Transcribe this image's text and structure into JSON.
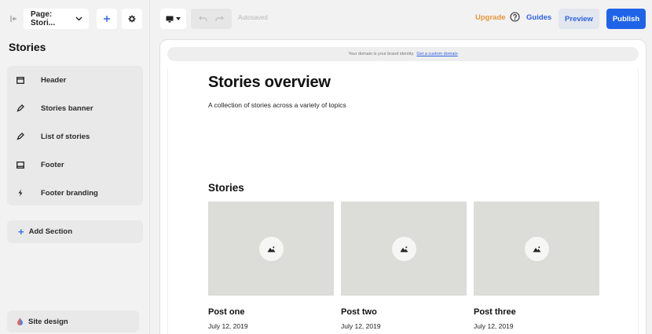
{
  "sidebar": {
    "page_selector": "Page: Stori...",
    "title": "Stories",
    "sections": [
      {
        "label": "Header",
        "icon": "window-icon"
      },
      {
        "label": "Stories banner",
        "icon": "pencil-icon"
      },
      {
        "label": "List of stories",
        "icon": "pencil-icon"
      },
      {
        "label": "Footer",
        "icon": "window-icon"
      },
      {
        "label": "Footer branding",
        "icon": "lightning-icon"
      }
    ],
    "add_section": "Add Section",
    "site_design": "Site design"
  },
  "toolbar": {
    "autosaved": "Autosaved",
    "upgrade": "Upgrade",
    "guides": "Guides",
    "preview": "Preview",
    "publish": "Publish"
  },
  "canvas": {
    "domain_notice": "Your domain is your brand identity.",
    "domain_link": "Get a custom domain",
    "hero_title": "Stories overview",
    "hero_subtitle": "A collection of stories across a variety of topics",
    "stories_heading": "Stories",
    "posts": [
      {
        "title": "Post one",
        "date": "July 12, 2019"
      },
      {
        "title": "Post two",
        "date": "July 12, 2019"
      },
      {
        "title": "Post three",
        "date": "July 12, 2019"
      }
    ]
  },
  "colors": {
    "accent": "#1f63e8",
    "link": "#2f62e0",
    "upgrade": "#e8973a"
  }
}
